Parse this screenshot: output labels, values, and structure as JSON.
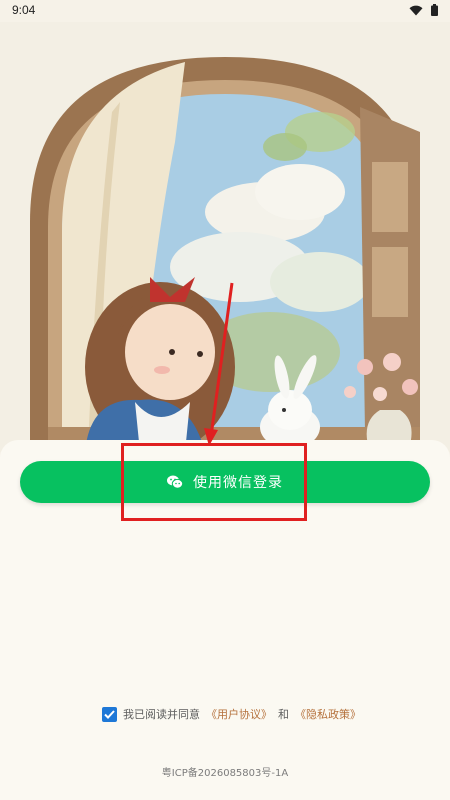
{
  "status_bar": {
    "time": "9:04",
    "icons": [
      "wifi-icon",
      "battery-icon"
    ]
  },
  "login": {
    "wechat_label": "使用微信登录"
  },
  "agreement": {
    "checked": true,
    "prefix": "我已阅读并同意",
    "user_agreement": "《用户协议》",
    "conjunction": "和",
    "privacy_policy": "《隐私政策》"
  },
  "footer": {
    "icp": "粤ICP备2026085803号-1A"
  },
  "colors": {
    "accent": "#07c160",
    "link": "#b5713c",
    "checkbox": "#1e78d7",
    "annotation": "#e02020"
  }
}
